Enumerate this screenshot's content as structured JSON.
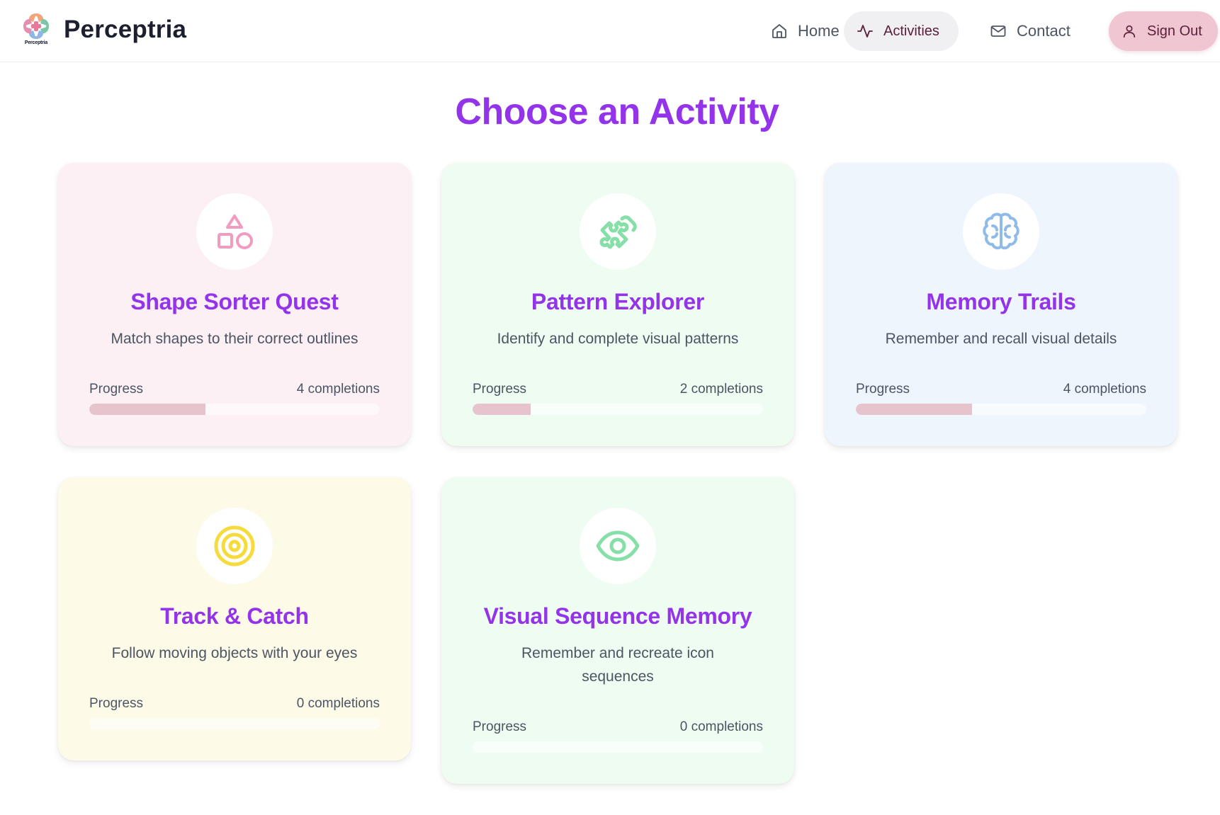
{
  "header": {
    "brand_name": "Perceptria",
    "logo_caption": "Perceptria",
    "nav": {
      "home": "Home",
      "activities": "Activities",
      "contact": "Contact",
      "sign_out": "Sign Out"
    }
  },
  "page_title": "Choose an Activity",
  "progress_fill_color": "#e6c3cd",
  "cards": [
    {
      "title": "Shape Sorter Quest",
      "description": "Match shapes to their correct outlines",
      "progress_label": "Progress",
      "completions": "4 completions",
      "progress_fraction": 0.4,
      "icon": "shapes-icon",
      "accent": "#f29bc1"
    },
    {
      "title": "Pattern Explorer",
      "description": "Identify and complete visual patterns",
      "progress_label": "Progress",
      "completions": "2 completions",
      "progress_fraction": 0.2,
      "icon": "puzzle-icon",
      "accent": "#86dfa6"
    },
    {
      "title": "Memory Trails",
      "description": "Remember and recall visual details",
      "progress_label": "Progress",
      "completions": "4 completions",
      "progress_fraction": 0.4,
      "icon": "brain-icon",
      "accent": "#8fbbe9"
    },
    {
      "title": "Track & Catch",
      "description": "Follow moving objects with your eyes",
      "progress_label": "Progress",
      "completions": "0 completions",
      "progress_fraction": 0,
      "icon": "target-icon",
      "accent": "#f5db3b"
    },
    {
      "title": "Visual Sequence Memory",
      "description": "Remember and recreate icon sequences",
      "progress_label": "Progress",
      "completions": "0 completions",
      "progress_fraction": 0,
      "icon": "eye-icon",
      "accent": "#86dfa6"
    }
  ]
}
